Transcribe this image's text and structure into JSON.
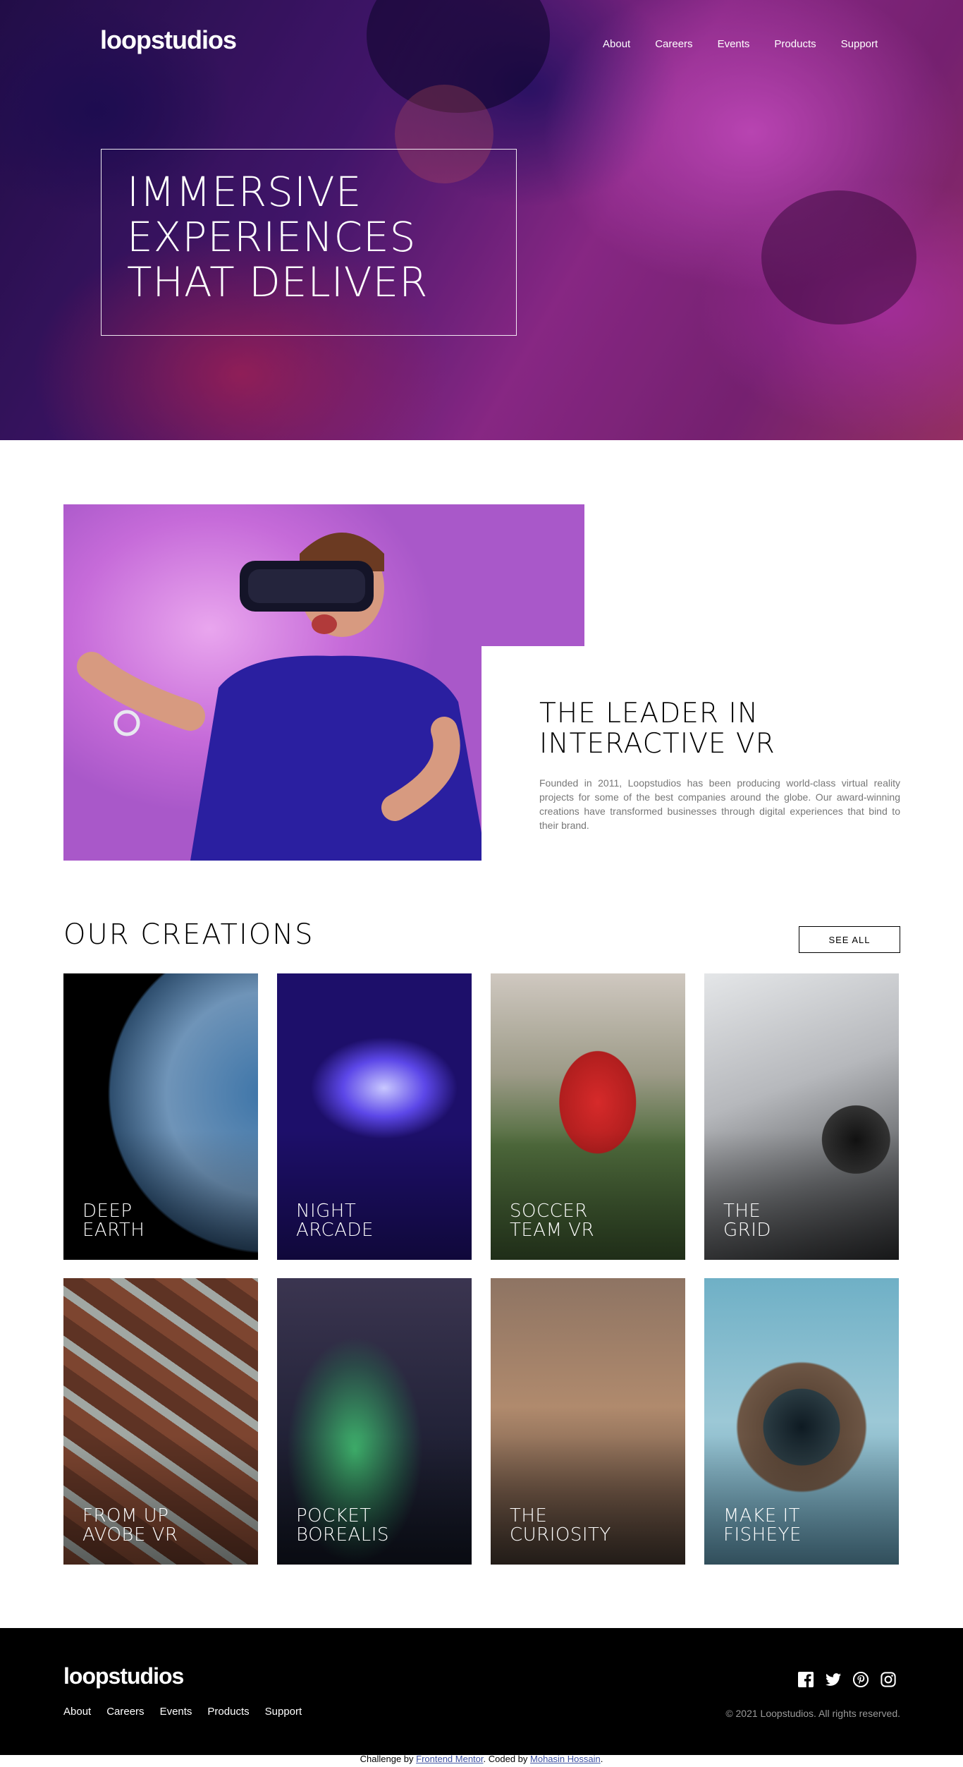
{
  "header": {
    "logo": "loopstudios",
    "nav": [
      "About",
      "Careers",
      "Events",
      "Products",
      "Support"
    ]
  },
  "hero": {
    "title": "IMMERSIVE\nEXPERIENCES\nTHAT DELIVER"
  },
  "intro": {
    "title": "THE LEADER IN\nINTERACTIVE VR",
    "text": "Founded in 2011, Loopstudios has been producing world-class virtual reality projects for some of the best companies around the globe. Our award-winning creations have transformed businesses through digital experiences that bind to their brand."
  },
  "creations": {
    "title": "OUR CREATIONS",
    "see_all": "SEE ALL",
    "items": [
      {
        "label": "DEEP\nEARTH"
      },
      {
        "label": "NIGHT\nARCADE"
      },
      {
        "label": "SOCCER\nTEAM VR"
      },
      {
        "label": "THE\nGRID"
      },
      {
        "label": "FROM UP\nAVOBE VR"
      },
      {
        "label": "POCKET\nBOREALIS"
      },
      {
        "label": "THE\nCURIOSITY"
      },
      {
        "label": "MAKE IT\nFISHEYE"
      }
    ]
  },
  "footer": {
    "logo": "loopstudios",
    "nav": [
      "About",
      "Careers",
      "Events",
      "Products",
      "Support"
    ],
    "socials": [
      "facebook-icon",
      "twitter-icon",
      "pinterest-icon",
      "instagram-icon"
    ],
    "copyright": "© 2021 Loopstudios. All rights reserved."
  },
  "attribution": {
    "prefix": "Challenge by ",
    "challenge_link": "Frontend Mentor",
    "middle": ". Coded by ",
    "author_link": "Mohasin Hossain",
    "suffix": "."
  },
  "colors": {
    "hero_accent": "#a03098",
    "footer_bg": "#000000",
    "link": "#3e52a3"
  }
}
